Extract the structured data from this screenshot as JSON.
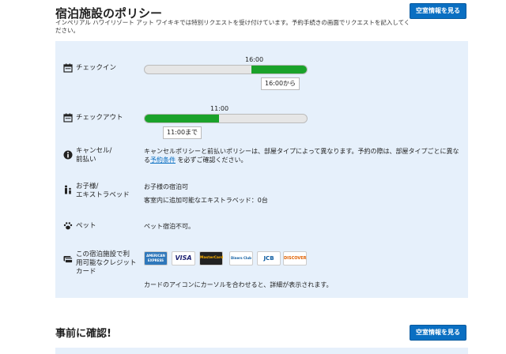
{
  "header": {
    "title": "宿泊施設のポリシー",
    "subtitle": "インペリアル ハワイリゾート アット ワイキキでは特別リクエストを受け付けています。予約手続きの画面でリクエストを記入してください。",
    "availability_button": "空室情報を見る"
  },
  "checkin": {
    "label": "チェックイン",
    "time": "16:00",
    "callout": "16:00から",
    "fill_start": 0.66,
    "fill_end": 1.0
  },
  "checkout": {
    "label": "チェックアウト",
    "time": "11:00",
    "callout": "11:00まで",
    "fill_start": 0.0,
    "fill_end": 0.46
  },
  "cancel": {
    "label_line1": "キャンセル/",
    "label_line2": "前払い",
    "text_before": "キャンセルポリシーと前払いポリシーは、部屋タイプによって異なります。予約の際は、部屋タイプごとに異なる",
    "link": "予約条件",
    "text_after": " を必ずご確認ください。"
  },
  "children": {
    "label_line1": "お子様/",
    "label_line2": "エキストラベッド",
    "line1": "お子様の宿泊可",
    "line2": "客室内に追加可能なエキストラベッド：0台"
  },
  "pets": {
    "label": "ペット",
    "text": "ペット宿泊不可。"
  },
  "cards": {
    "label_line1": "この宿泊施設で利",
    "label_line2": "用可能なクレジット",
    "label_line3": "カード",
    "items": [
      {
        "name": "AMERICAN EXPRESS",
        "color": "#2e77bb"
      },
      {
        "name": "VISA",
        "color": "#ffffff"
      },
      {
        "name": "MasterCard",
        "color": "#222222"
      },
      {
        "name": "Diners Club",
        "color": "#ffffff"
      },
      {
        "name": "JCB",
        "color": "#ffffff"
      },
      {
        "name": "DISCOVER",
        "color": "#ffffff"
      }
    ],
    "hint": "カードのアイコンにカーソルを合わせると、詳細が表示されます。"
  },
  "section2": {
    "title": "事前に確認!",
    "availability_button": "空室情報を見る"
  },
  "colors": {
    "accent": "#0a6fc2",
    "bar_fill": "#1aa22a",
    "panel_bg": "#e6f0fb"
  }
}
